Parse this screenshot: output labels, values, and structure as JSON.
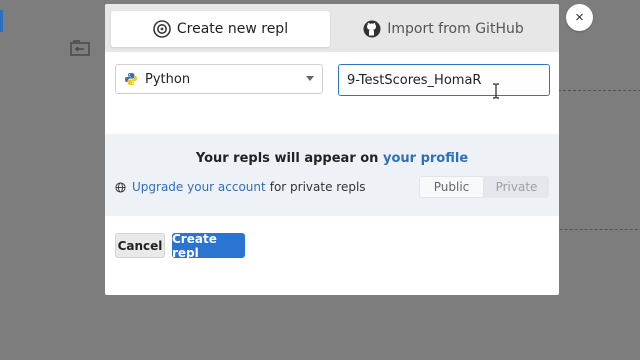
{
  "modal": {
    "tabs": [
      {
        "label": "Create new repl",
        "icon": "replit-icon",
        "active": true
      },
      {
        "label": "Import from GitHub",
        "icon": "github-icon",
        "active": false
      }
    ],
    "language": {
      "selected": "Python",
      "icon": "python-icon"
    },
    "repl_name": {
      "value": "9-TestScores_HomaR"
    },
    "info": {
      "title_prefix": "Your repls will appear on",
      "profile_link": "your profile",
      "upgrade_link": "Upgrade your account",
      "upgrade_suffix": "for private repls",
      "visibility_options": [
        "Public",
        "Private"
      ],
      "visibility_selected": "Public"
    },
    "buttons": {
      "cancel": "Cancel",
      "create": "Create repl"
    }
  },
  "close_symbol": "×",
  "colors": {
    "accent": "#2c74d2",
    "link": "#2f6fb8",
    "info_band": "#eef2f7",
    "overlay": "#7d7d7d"
  }
}
